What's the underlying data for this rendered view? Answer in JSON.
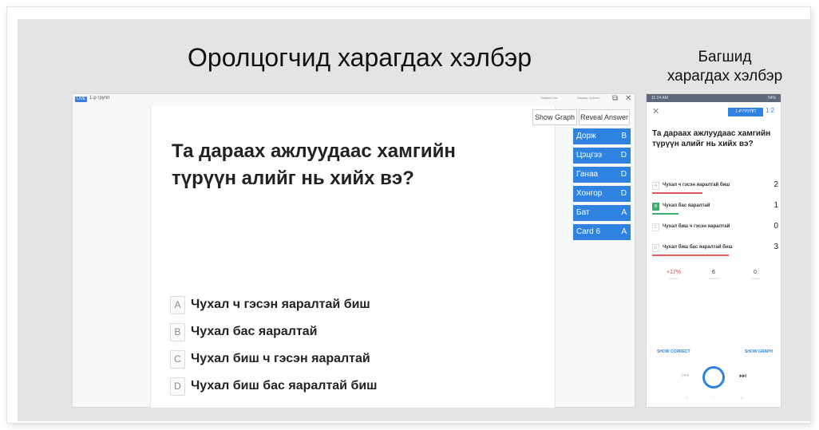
{
  "titles": {
    "participant": "Оролцогчид харагдах хэлбэр",
    "teacher_line1": "Багшид",
    "teacher_line2": "харагдах хэлбэр"
  },
  "participant_view": {
    "live_badge": "LIVE",
    "group_name": "1-р групп",
    "top_links": [
      "Student List",
      "Display Options"
    ],
    "question": "Та дараах ажлуудаас хамгийн түрүүн алийг нь хийх вэ?",
    "buttons": {
      "show_graph": "Show Graph",
      "reveal_answer": "Reveal Answer"
    },
    "answers": [
      {
        "letter": "A",
        "text": "Чухал ч гэсэн яаралтай биш"
      },
      {
        "letter": "B",
        "text": "Чухал бас яаралтай"
      },
      {
        "letter": "C",
        "text": "Чухал биш ч гэсэн яаралтай"
      },
      {
        "letter": "D",
        "text": "Чухал биш бас яаралтай биш"
      }
    ],
    "cards": [
      {
        "name": "Дорж",
        "answer": "B"
      },
      {
        "name": "Цэцгээ",
        "answer": "D"
      },
      {
        "name": "Ганаа",
        "answer": "D"
      },
      {
        "name": "Хонгор",
        "answer": "D"
      },
      {
        "name": "Бат",
        "answer": "A"
      },
      {
        "name": "Card 6",
        "answer": "A"
      }
    ]
  },
  "teacher_view": {
    "status_left": "11:24 AM",
    "status_right": "54%",
    "group_name": "1-Р ГРУПП",
    "pages": "1 2",
    "question": "Та дараах ажлуудаас хамгийн түрүүн алийг нь хийх вэ?",
    "answers": [
      {
        "letter": "A",
        "text": "Чухал ч гэсэн яаралтай биш",
        "count": "2",
        "correct": false,
        "bar_color": "#e05a5a",
        "fraction": 0.33
      },
      {
        "letter": "B",
        "text": "Чухал бас яаралтай",
        "count": "1",
        "correct": true,
        "bar_color": "#38b26b",
        "fraction": 0.17
      },
      {
        "letter": "C",
        "text": "Чухал биш ч гэсэн яаралтай",
        "count": "0",
        "correct": false,
        "bar_color": "#e05a5a",
        "fraction": 0
      },
      {
        "letter": "D",
        "text": "Чухал биш бас яаралтай биш",
        "count": "3",
        "correct": false,
        "bar_color": "#e05a5a",
        "fraction": 0.5
      }
    ],
    "stats": [
      {
        "value": "+17%",
        "label": "average"
      },
      {
        "value": "6",
        "label": "answered"
      },
      {
        "value": "0",
        "label": "missing"
      }
    ],
    "links": {
      "show_correct": "SHOW CORRECT",
      "show_graph": "SHOW GRAPH"
    }
  },
  "colors": {
    "accent": "#2f83e0",
    "correct": "#38b26b",
    "wrong": "#e05a5a",
    "panel_bg": "#e4e4e4"
  }
}
